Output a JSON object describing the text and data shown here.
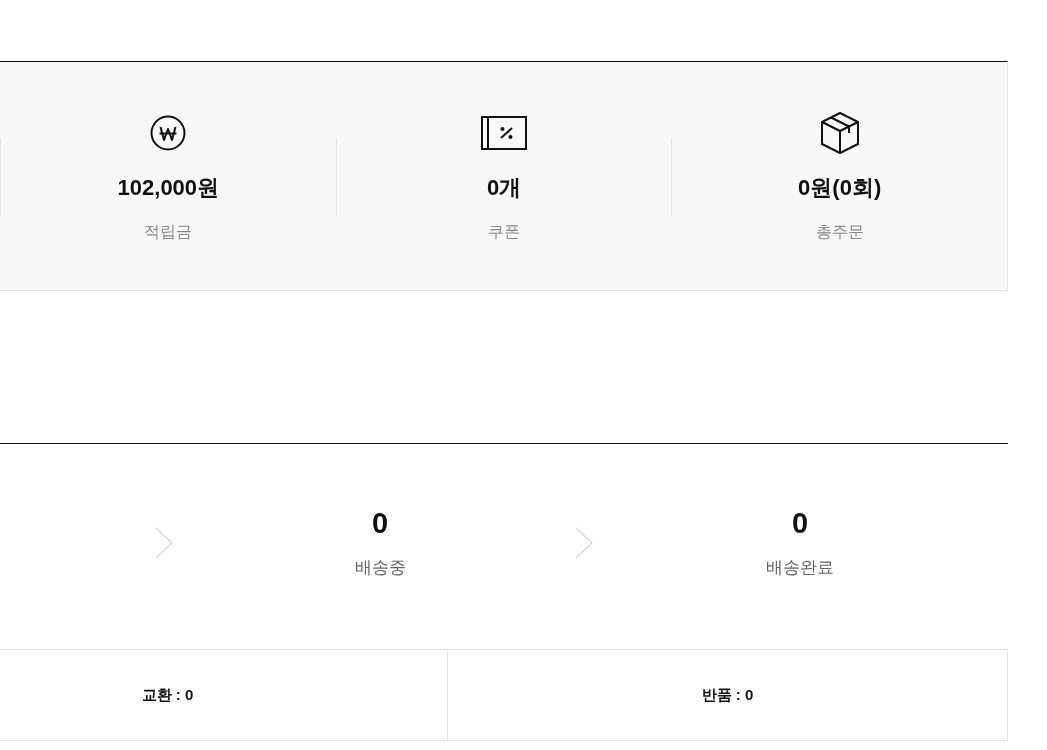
{
  "summary": {
    "items": [
      {
        "kind": "points",
        "value": "102,000원",
        "label": "적립금"
      },
      {
        "kind": "coupon",
        "value": "0개",
        "label": "쿠폰"
      },
      {
        "kind": "orders",
        "value": "0원(0회)",
        "label": "총주문"
      }
    ]
  },
  "order_status": {
    "steps": [
      {
        "count": "0",
        "label": "배송중"
      },
      {
        "count": "0",
        "label": "배송완료"
      }
    ]
  },
  "claims": [
    "교환 : 0",
    "반품 : 0"
  ]
}
